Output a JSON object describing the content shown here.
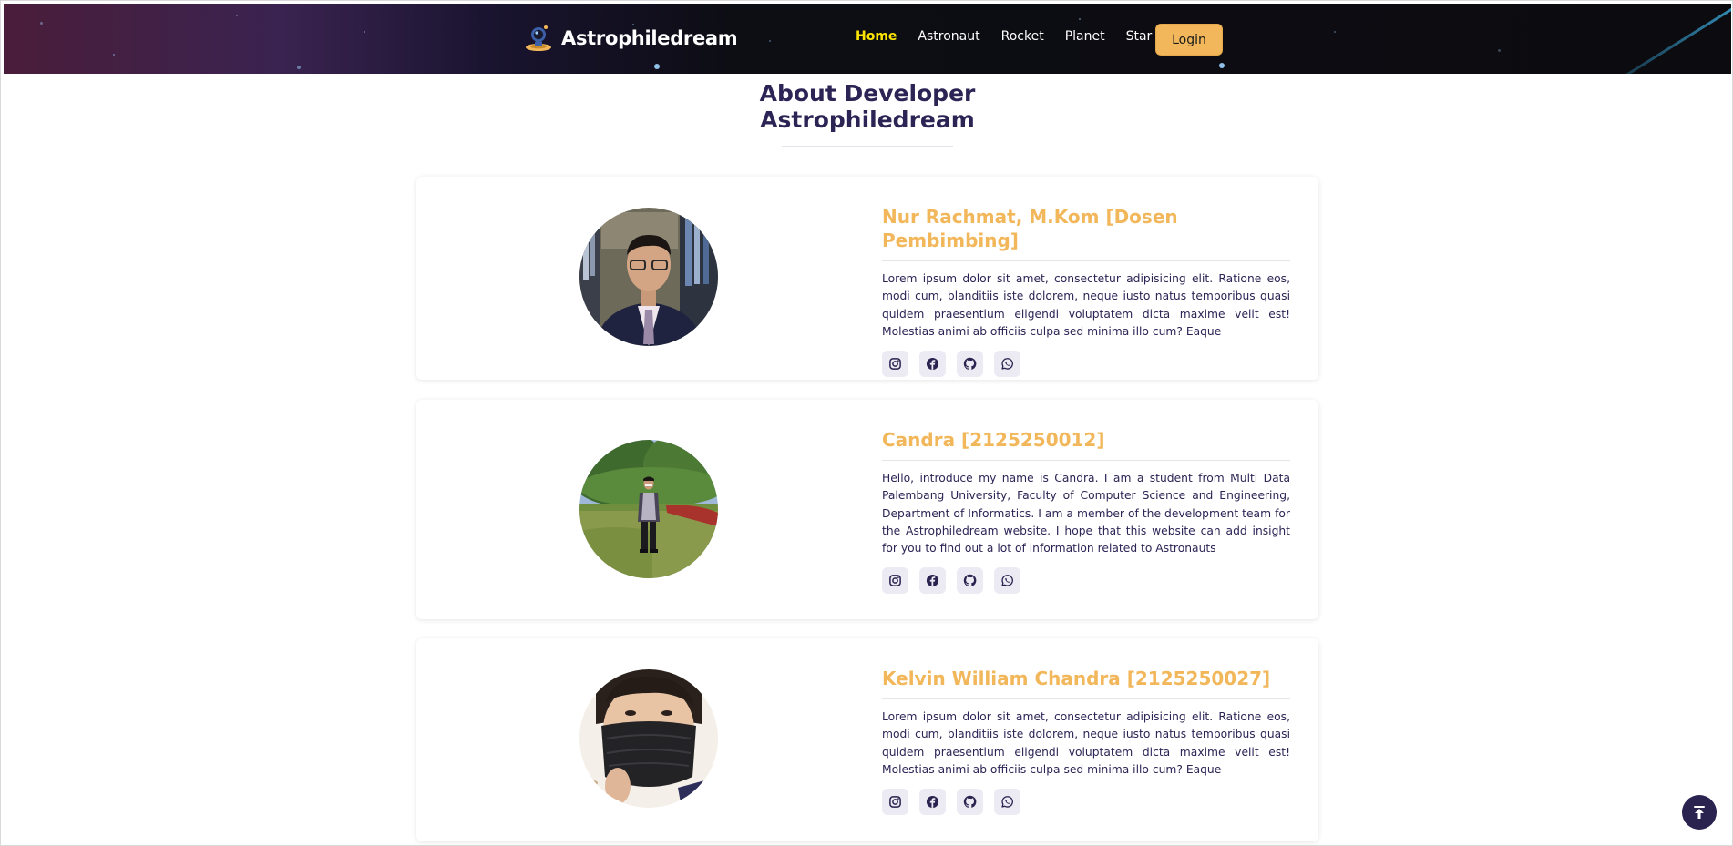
{
  "navbar": {
    "brand": "Astrophiledream",
    "links": [
      "Home",
      "Astronaut",
      "Rocket",
      "Planet",
      "Star"
    ],
    "active": "Home",
    "login_label": "Login",
    "colors": {
      "active": "#ffe600",
      "login_bg": "#f2b75a"
    }
  },
  "page": {
    "title_line1": "About Developer",
    "title_line2": "Astrophiledream"
  },
  "developers": [
    {
      "name": "Nur Rachmat, M.Kom [Dosen Pembimbing]",
      "bio": "Lorem ipsum dolor sit amet, consectetur adipisicing elit. Ratione eos, modi cum, blanditiis iste dolorem, neque iusto natus temporibus quasi quidem praesentium eligendi voluptatem dicta maxime velit est! Molestias animi ab officiis culpa sed minima illo cum? Eaque",
      "socials": [
        "instagram-icon",
        "facebook-icon",
        "github-icon",
        "whatsapp-icon"
      ]
    },
    {
      "name": "Candra [2125250012]",
      "bio": "Hello, introduce my name is Candra. I am a student from Multi Data Palembang University, Faculty of Computer Science and Engineering, Department of Informatics. I am a member of the development team for the Astrophiledream website. I hope that this website can add insight for you to find out a lot of information related to Astronauts",
      "socials": [
        "instagram-icon",
        "facebook-icon",
        "github-icon",
        "whatsapp-icon"
      ]
    },
    {
      "name": "Kelvin William Chandra [2125250027]",
      "bio": "Lorem ipsum dolor sit amet, consectetur adipisicing elit. Ratione eos, modi cum, blanditiis iste dolorem, neque iusto natus temporibus quasi quidem praesentium eligendi voluptatem dicta maxime velit est! Molestias animi ab officiis culpa sed minima illo cum? Eaque",
      "socials": [
        "instagram-icon",
        "facebook-icon",
        "github-icon",
        "whatsapp-icon"
      ]
    }
  ],
  "back_to_top_icon": "arrow-up-to-line-icon"
}
